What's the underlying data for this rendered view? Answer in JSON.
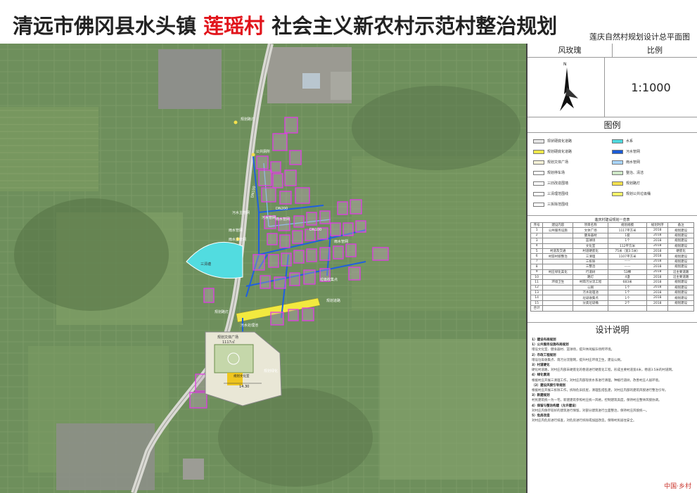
{
  "title": {
    "prefix": "清远市佛冈县水头镇",
    "highlight": "莲瑶村",
    "suffix": "社会主义新农村示范村整治规划",
    "highlight_color": "#e1141b"
  },
  "subtitle": "莲庆自然村规划设计总平面图",
  "panel": {
    "compass_label": "风玫瑰",
    "scale_label": "比例",
    "scale_value": "1:1000",
    "north": "N",
    "legend_title": "图例",
    "description_title": "设计说明",
    "table_caption": "莲庆村建设规划一览表"
  },
  "legend": [
    {
      "label": "现状硬底化道路",
      "color": "#e6e6e6"
    },
    {
      "label": "水系",
      "color": "#4fd9de"
    },
    {
      "label": "规划硬底化道路",
      "color": "#f0e94a"
    },
    {
      "label": "污水管网",
      "color": "#1a5bd6"
    },
    {
      "label": "规划文体广场",
      "color": "#f3f0d6"
    },
    {
      "label": "雨水管网",
      "color": "#a9d6ff"
    },
    {
      "label": "规划停车场",
      "color": "#ffffff"
    },
    {
      "label": "整治、清洁",
      "color": "#cfe8c8"
    },
    {
      "label": "三旧改造围墙",
      "color": "#ffffff"
    },
    {
      "label": "规划路灯",
      "color": "#f4e04d"
    },
    {
      "label": "三清理范围线",
      "color": "#ffffff"
    },
    {
      "label": "规划公共垃圾桶",
      "color": "#f7f56a"
    },
    {
      "label": "三拆除范围线",
      "color": "#ffffff"
    }
  ],
  "table": {
    "headers": [
      "序号",
      "建设内容",
      "项目名称",
      "规划规模",
      "规划时序",
      "备注"
    ],
    "rows": [
      [
        "1",
        "公共服务设施",
        "文体广场",
        "1117平方米",
        "2018",
        "规划建设"
      ],
      [
        "2",
        "",
        "健身器材",
        "1套",
        "2018",
        "规划建设"
      ],
      [
        "3",
        "",
        "篮球场",
        "1个",
        "2018",
        "规划建设"
      ],
      [
        "4",
        "",
        "文化室",
        "112平方米",
        "2018",
        "规划建设"
      ],
      [
        "5",
        "村道及交通",
        "村道硬底化",
        "75米（宽3.5米）",
        "2018",
        "硬底化"
      ],
      [
        "6",
        "村容村貌整治",
        "三清理",
        "1107平方米",
        "2018",
        "规划建设"
      ],
      [
        "7",
        "",
        "三拆除",
        "——",
        "2018",
        "规划建设"
      ],
      [
        "8",
        "",
        "三整治",
        "——",
        "2018",
        "规划建设"
      ],
      [
        "9",
        "村庄绿化美化",
        "行道树",
        "53棵",
        "2018",
        "沿主要道路"
      ],
      [
        "10",
        "",
        "路灯",
        "4盏",
        "2018",
        "沿主要道路"
      ],
      [
        "11",
        "环境卫生",
        "村雨污分流工程",
        "683米",
        "2018",
        "规划建设"
      ],
      [
        "12",
        "",
        "公厕",
        "1个",
        "2018",
        "规划建设"
      ],
      [
        "13",
        "",
        "污水处理池",
        "1个",
        "2018",
        "规划建设"
      ],
      [
        "14",
        "",
        "垃圾收集点",
        "1个",
        "2018",
        "规划建设"
      ],
      [
        "15",
        "",
        "分类垃圾桶",
        "2个",
        "2018",
        "规划建设"
      ],
      [
        "合计",
        "",
        "",
        "",
        "",
        ""
      ]
    ]
  },
  "description": [
    {
      "head": "1）建设布局规划",
      "text": ""
    },
    {
      "head": "1）公共服务设施布局规划",
      "text": "增设文化室、健身器材、篮球场，提升休闲娱乐场所环境。"
    },
    {
      "head": "2）市政工程规划",
      "text": "增设垃圾收集点、雨污分流管网，提升村庄环境卫生，建设公厕。"
    },
    {
      "head": "3）村道硬化",
      "text": "硬化村道路，对村庄内部未硬底化的巷道进行硬底化工程，形成主要村道宽4米，巷道3.5米的村道网。"
    },
    {
      "head": "4）绿化景观",
      "text": "根据村庄开展三清理工作，对村庄内部现状水系进行清理，种植行道树，改善村庄人居环境。"
    },
    {
      "head": "（2）建设风貌引导规划",
      "text": "根据村庄开展三拆除工作，拆除危旧房屋，清理乱搭乱建，对村庄内部的建筑风貌进行整治引导。"
    },
    {
      "head": "3）新建规划",
      "text": "村民建筑统一为一宅，新建建筑参照村庄统一风格，控制建筑高度，保持村庄整体风貌协调。"
    },
    {
      "head": "4）保留与整治构建（允许建设）",
      "text": "对村庄内保存较好的建筑进行保留，对部分建筑进行立面整治，保持村庄风貌统一。"
    },
    {
      "head": "5）危房改造",
      "text": "对村庄内危房进行排查，对危房进行拆除或加固改造，保障村民居住安全。"
    }
  ],
  "map_labels": {
    "road": "规划道路",
    "streetlight_1": "规划路灯",
    "streetlight_2": "规划路灯",
    "toilet": "公共厕所",
    "sewage_main": "污水主管网",
    "sewage_pipe": "污水管网",
    "rain_pipe": "雨水管网",
    "rain_pipe_2": "雨水管网",
    "rain_main": "雨水主管网",
    "rain_pipe_3": "雨水管网",
    "water": "三清塘",
    "square": "规划文体广场",
    "square_area": "1117㎡",
    "culture_room": "规划文化室",
    "court": "篮球场",
    "trash": "污水处理池",
    "road_dims": "14.30",
    "parking": "规划停车场",
    "garbage": "垃圾收集点",
    "green": "规划绿化",
    "dn1": "DN100",
    "dn2": "DN100",
    "dn3": "DN200"
  },
  "watermark": "中国·乡村"
}
